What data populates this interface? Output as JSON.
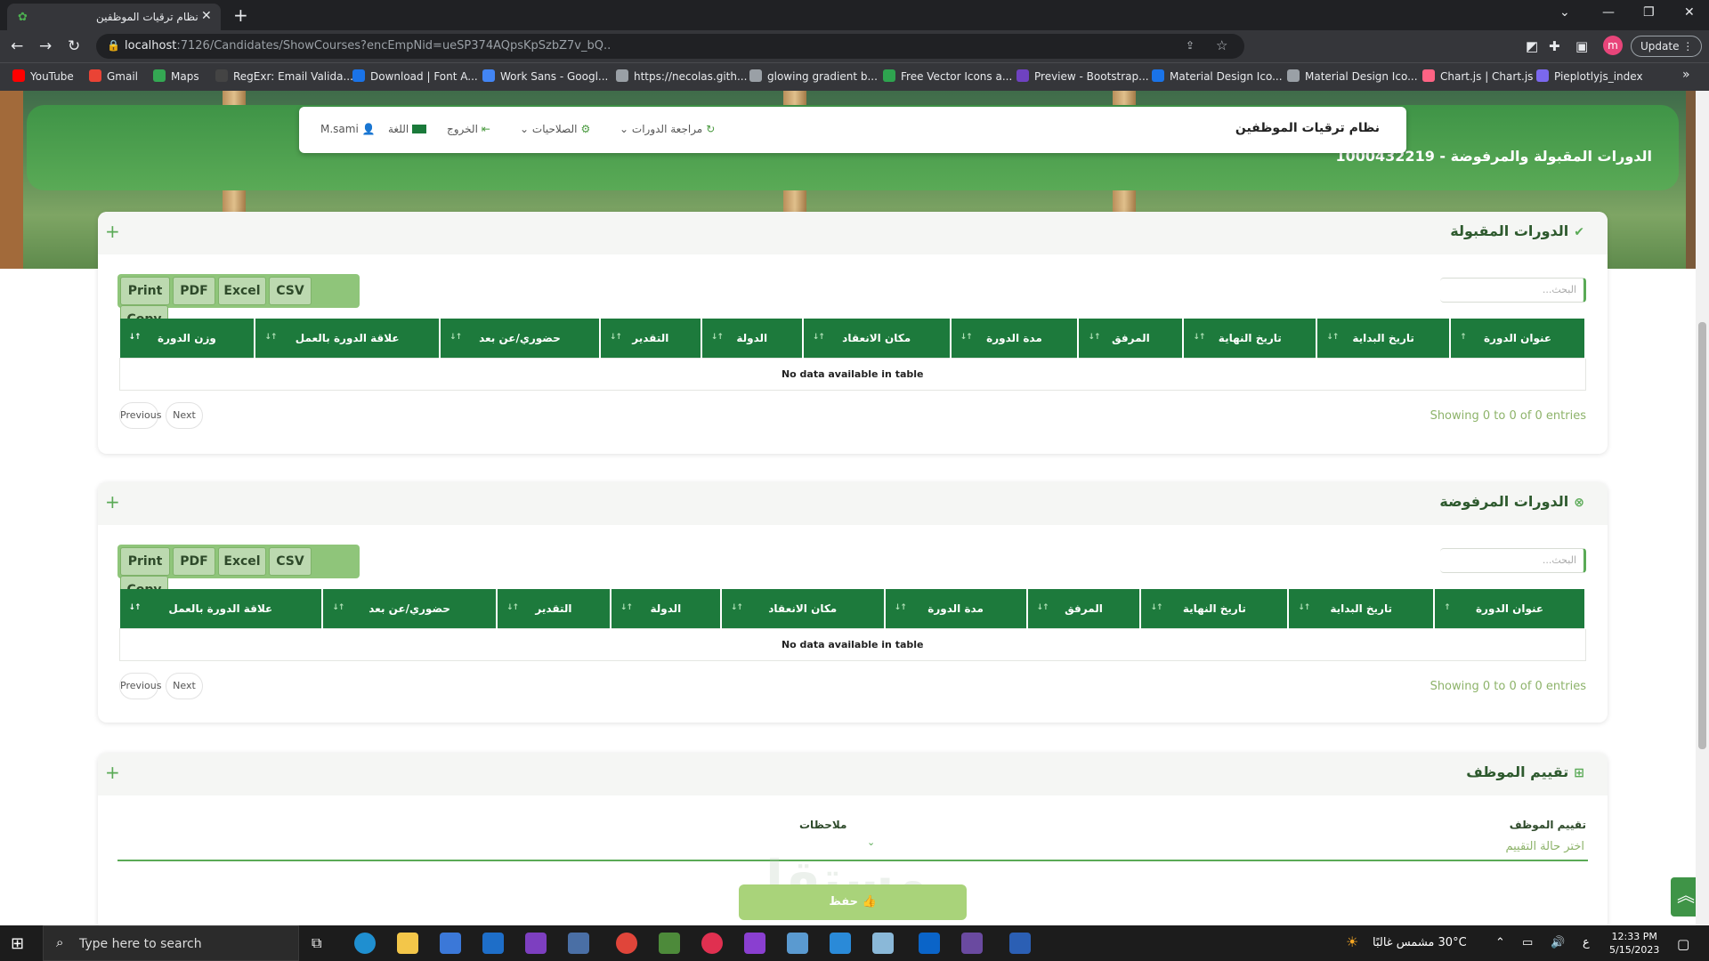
{
  "browser": {
    "tab_title": "نظام ترقيات الموظفين",
    "url_host": "localhost",
    "url_rest": ":7126/Candidates/ShowCourses?encEmpNid=ueSP374AQpsKpSzbZ7v_bQ..",
    "update_label": "Update",
    "profile_initial": "m",
    "bookmarks": [
      "YouTube",
      "Gmail",
      "Maps",
      "RegExr: Email Valida...",
      "Download | Font A...",
      "Work Sans - Googl...",
      "https://necolas.gith...",
      "glowing gradient b...",
      "Free Vector Icons a...",
      "Preview - Bootstrap...",
      "Material Design Ico...",
      "Material Design Ico...",
      "Chart.js | Chart.js",
      "Pieplotlyjs_index"
    ],
    "bookmark_colors": [
      "#ff0000",
      "#ea4335",
      "#34a853",
      "#444444",
      "#1a73e8",
      "#4285f4",
      "#9aa0a6",
      "#9aa0a6",
      "#2ea44f",
      "#6f42c1",
      "#1a73e8",
      "#9aa0a6",
      "#ff6384",
      "#7b68ee"
    ]
  },
  "nav": {
    "brand": "نظام ترقيات الموظفين",
    "course_review": "مراجعة الدورات",
    "permissions": "الصلاحيات",
    "logout": "الخروج",
    "language": "اللغة",
    "user": "M.sami"
  },
  "page_title": "الدورات المقبولة والمرفوضة - 1000432219",
  "accepted": {
    "title": "الدورات المقبولة",
    "buttons": [
      "Print",
      "PDF",
      "Excel",
      "CSV",
      "Copy"
    ],
    "search_placeholder": "البحث...",
    "columns": [
      "عنوان الدورة",
      "تاريخ البداية",
      "تاريخ النهاية",
      "المرفق",
      "مدة الدورة",
      "مكان الانعقاد",
      "الدولة",
      "التقدير",
      "حضوري/عن بعد",
      "علاقة الدورة بالعمل",
      "وزن الدورة"
    ],
    "empty": "No data available in table",
    "info": "Showing 0 to 0 of 0 entries",
    "prev": "Previous",
    "next": "Next"
  },
  "rejected": {
    "title": "الدورات المرفوضة",
    "buttons": [
      "Print",
      "PDF",
      "Excel",
      "CSV",
      "Copy"
    ],
    "search_placeholder": "البحث...",
    "columns": [
      "عنوان الدورة",
      "تاريخ البداية",
      "تاريخ النهاية",
      "المرفق",
      "مدة الدورة",
      "مكان الانعقاد",
      "الدولة",
      "التقدير",
      "حضوري/عن بعد",
      "علاقة الدورة بالعمل"
    ],
    "empty": "No data available in table",
    "info": "Showing 0 to 0 of 0 entries",
    "prev": "Previous",
    "next": "Next"
  },
  "evaluation": {
    "title": "تقييم الموظف",
    "rating_label": "تقييم الموظف",
    "rating_placeholder": "اختر حالة التقييم",
    "notes_label": "ملاحظات",
    "save_label": "حفظ"
  },
  "watermark": "مستقل",
  "taskbar": {
    "search_placeholder": "Type here to search",
    "weather": "30°C  مشمس غالبًا",
    "lang": "ع",
    "time": "12:33 PM",
    "date": "5/15/2023"
  },
  "colors": {
    "primary": "#1d7a3c",
    "accent": "#5aaa56",
    "light": "#8db36a"
  }
}
